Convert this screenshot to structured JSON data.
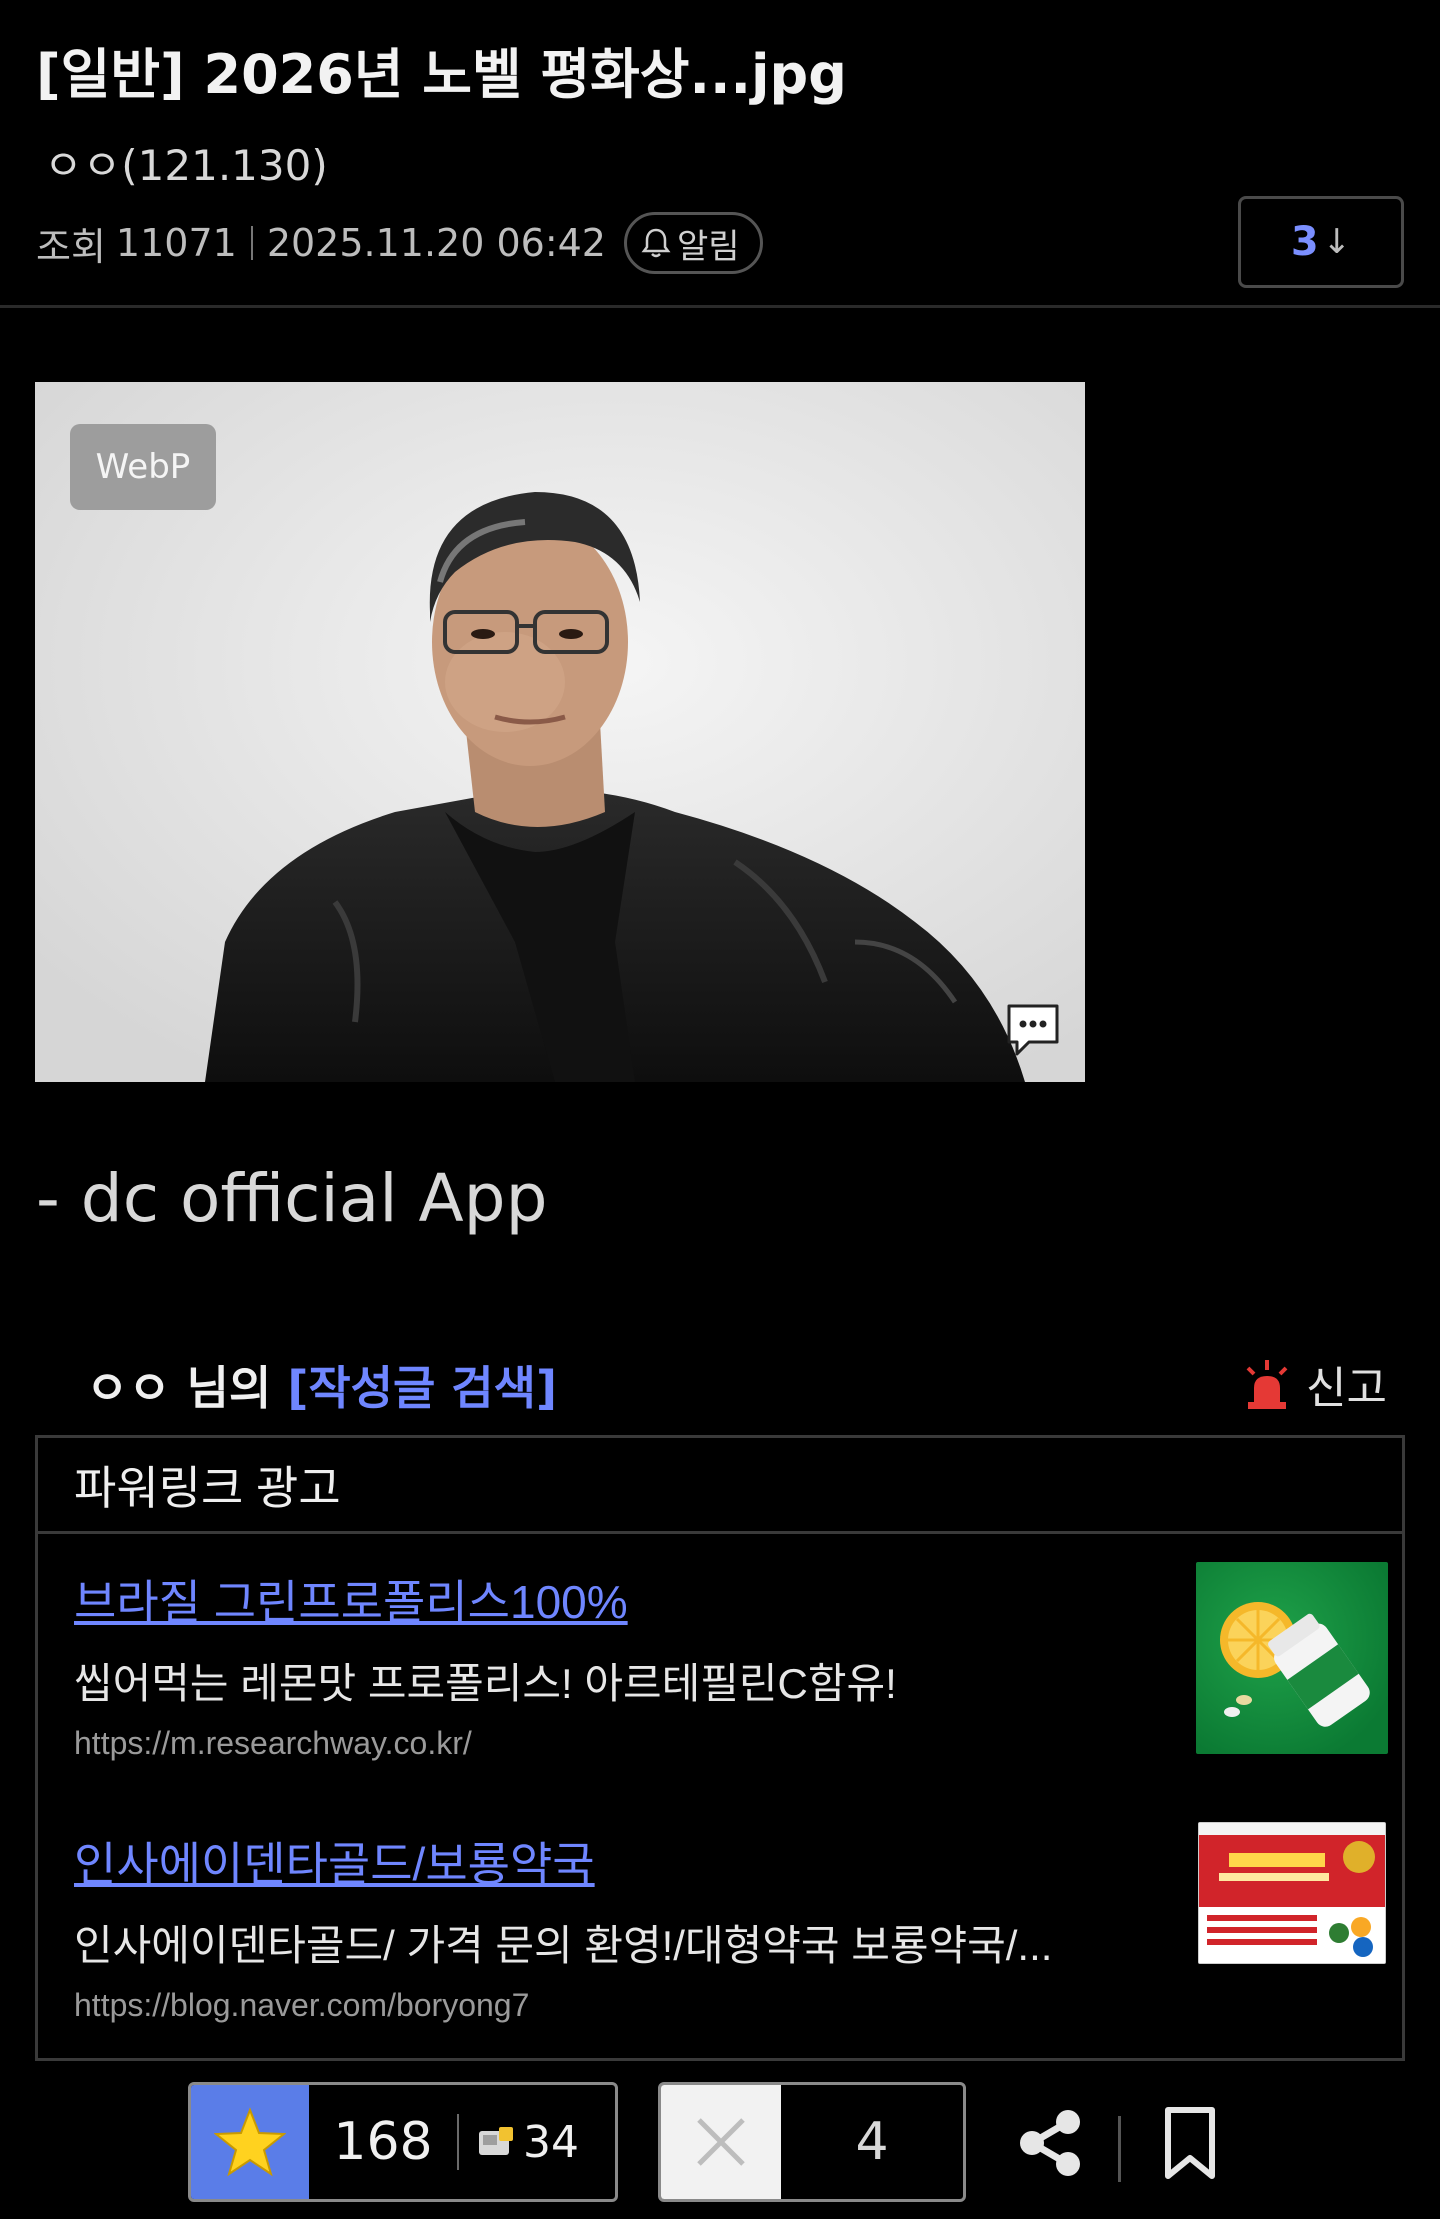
{
  "post": {
    "title": "[일반] 2026년 노벨 평화상...jpg",
    "author": "ㅇㅇ(121.130)",
    "views_label": "조회",
    "views": "11071",
    "datetime": "2025.11.20 06:42",
    "alarm_label": "알림",
    "comment_count": "3",
    "comment_arrow": "↓"
  },
  "image": {
    "badge": "WebP"
  },
  "body": {
    "app_sign": "- dc official App"
  },
  "author_row": {
    "nick": "ㅇㅇ 님의",
    "search_link": "[작성글 검색]",
    "report_label": "신고"
  },
  "ads": {
    "header": "파워링크 광고",
    "items": [
      {
        "title": "브라질 그린프로폴리스100%",
        "desc": "씹어먹는 레몬맛 프로폴리스! 아르테필린C함유!",
        "url": "https://m.researchway.co.kr/"
      },
      {
        "title": "인사에이덴타골드/보룡약국",
        "desc": "인사에이덴타골드/ 가격 문의 환영!/대형약국 보룡약국/...",
        "url": "https://blog.naver.com/boryong7"
      }
    ]
  },
  "actions": {
    "recommend_count": "168",
    "fix_recommend_count": "34",
    "non_recommend_count": "4"
  },
  "colors": {
    "accent_link": "#6f86ff",
    "recommend_bg": "#5a7de8",
    "report_red": "#e53935"
  }
}
